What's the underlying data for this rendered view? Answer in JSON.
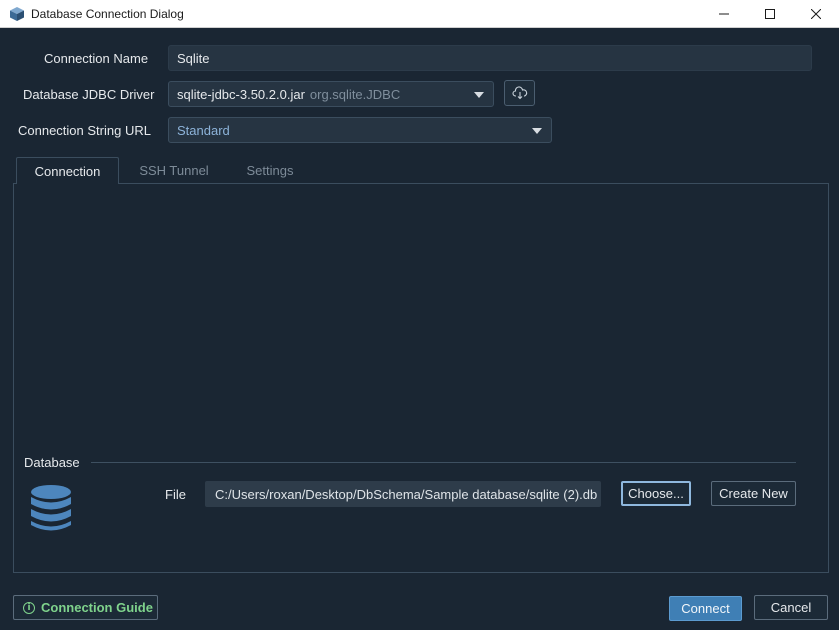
{
  "window": {
    "title": "Database Connection Dialog",
    "minimize_icon": "minimize-icon",
    "maximize_icon": "maximize-icon",
    "close_icon": "close-icon"
  },
  "form": {
    "connection_name_label": "Connection Name",
    "connection_name_value": "Sqlite",
    "driver_label": "Database JDBC Driver",
    "driver_value": "sqlite-jdbc-3.50.2.0.jar",
    "driver_hint": "org.sqlite.JDBC",
    "url_label": "Connection String URL",
    "url_value": "Standard"
  },
  "tabs": [
    {
      "label": "Connection",
      "active": true
    },
    {
      "label": "SSH Tunnel",
      "active": false
    },
    {
      "label": "Settings",
      "active": false
    }
  ],
  "database_group": {
    "title": "Database",
    "file_label": "File",
    "file_value": "C:/Users/roxan/Desktop/DbSchema/Sample database/sqlite (2).db",
    "choose_label": "Choose...",
    "create_label": "Create New"
  },
  "footer": {
    "guide_label": "Connection Guide",
    "connect_label": "Connect",
    "cancel_label": "Cancel"
  },
  "colors": {
    "background": "#1a2633",
    "accent": "#3f7fb5",
    "guide": "#7fd38c",
    "database_icon": "#4d86bd"
  }
}
